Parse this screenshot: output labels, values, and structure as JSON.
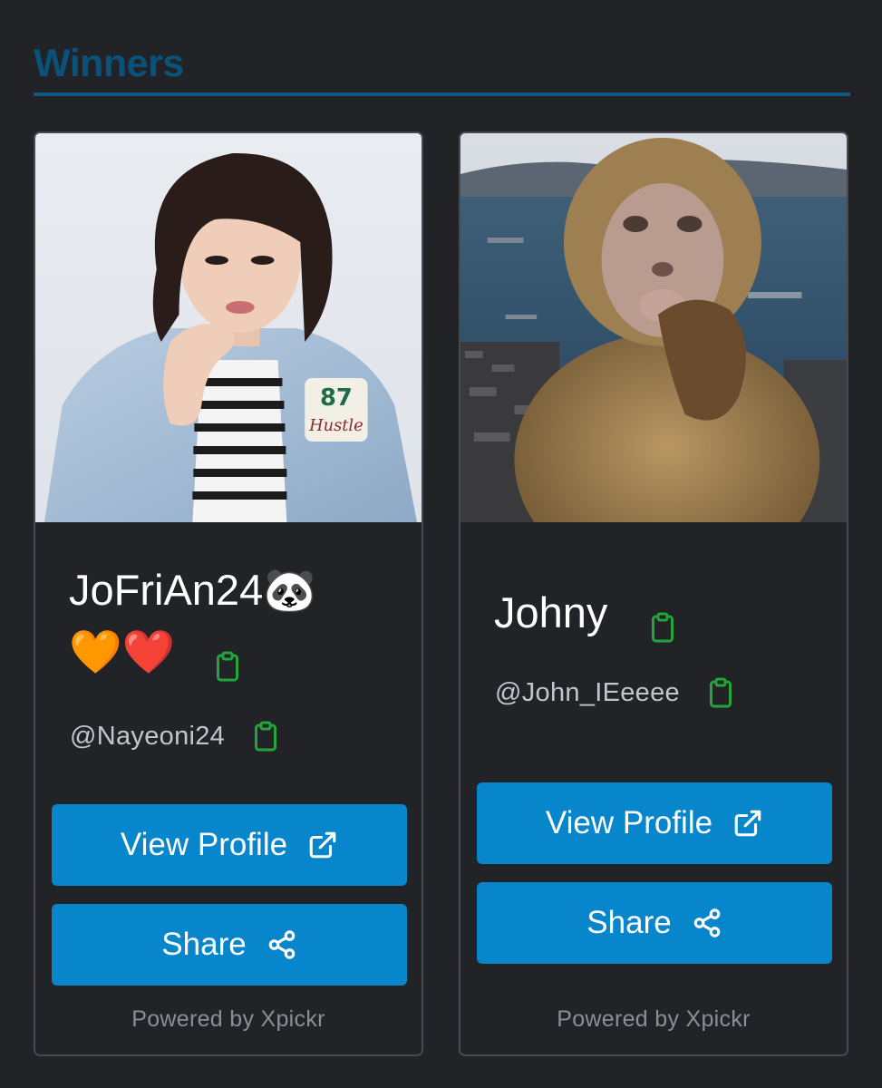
{
  "section": {
    "title": "Winners"
  },
  "colors": {
    "accent": "#0886cb",
    "title": "#0b5179",
    "copy_icon": "#22a53a",
    "background": "#222327"
  },
  "cards": [
    {
      "image_alt": "profile-photo-person-denim-jacket",
      "name": "JoFriAn24🐼",
      "name_emoji_line": "🧡❤️",
      "handle": "@Nayeoni24",
      "view_profile_label": "View Profile",
      "share_label": "Share",
      "powered_by": "Powered by Xpickr",
      "icons": {
        "copy": "clipboard-icon",
        "view": "external-link-icon",
        "share": "share-icon"
      }
    },
    {
      "image_alt": "profile-photo-monkey-harbor",
      "name": "Johny",
      "handle": "@John_IEeeee",
      "view_profile_label": "View Profile",
      "share_label": "Share",
      "powered_by": "Powered by Xpickr",
      "icons": {
        "copy": "clipboard-icon",
        "view": "external-link-icon",
        "share": "share-icon"
      }
    }
  ]
}
